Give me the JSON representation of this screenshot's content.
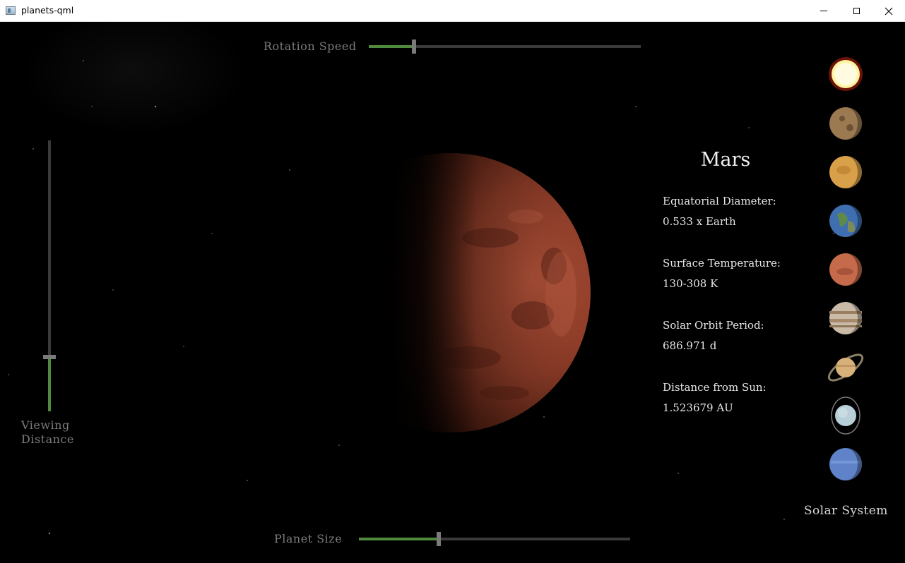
{
  "window": {
    "title": "planets-qml",
    "minimize_icon": "minimize-icon",
    "maximize_icon": "maximize-icon",
    "close_icon": "close-icon"
  },
  "controls": {
    "rotation_speed": {
      "label": "Rotation Speed",
      "value": 0.165
    },
    "planet_size": {
      "label": "Planet Size",
      "value": 0.295
    },
    "viewing_distance": {
      "label_line1": "Viewing",
      "label_line2": "Distance",
      "value": 0.2
    }
  },
  "planet_info": {
    "name": "Mars",
    "rows": [
      {
        "label": "Equatorial Diameter:",
        "value": "0.533 x Earth"
      },
      {
        "label": "Surface Temperature:",
        "value": "130-308 K"
      },
      {
        "label": "Solar Orbit Period:",
        "value": "686.971 d"
      },
      {
        "label": "Distance from Sun:",
        "value": "1.523679 AU"
      }
    ]
  },
  "selector": {
    "label": "Solar System",
    "planets": [
      {
        "name": "sun",
        "icon": "sun-icon",
        "color": "#ffd84a"
      },
      {
        "name": "mercury",
        "icon": "mercury-icon",
        "color": "#9b7a52"
      },
      {
        "name": "venus",
        "icon": "venus-icon",
        "color": "#d9a04a"
      },
      {
        "name": "earth",
        "icon": "earth-icon",
        "color": "#3f6fb0"
      },
      {
        "name": "mars",
        "icon": "mars-icon",
        "color": "#c56a4a"
      },
      {
        "name": "jupiter",
        "icon": "jupiter-icon",
        "color": "#c9bba8"
      },
      {
        "name": "saturn",
        "icon": "saturn-icon",
        "color": "#d8b07a"
      },
      {
        "name": "uranus",
        "icon": "uranus-icon",
        "color": "#b8cfd8"
      },
      {
        "name": "neptune",
        "icon": "neptune-icon",
        "color": "#5f82c9"
      }
    ]
  }
}
